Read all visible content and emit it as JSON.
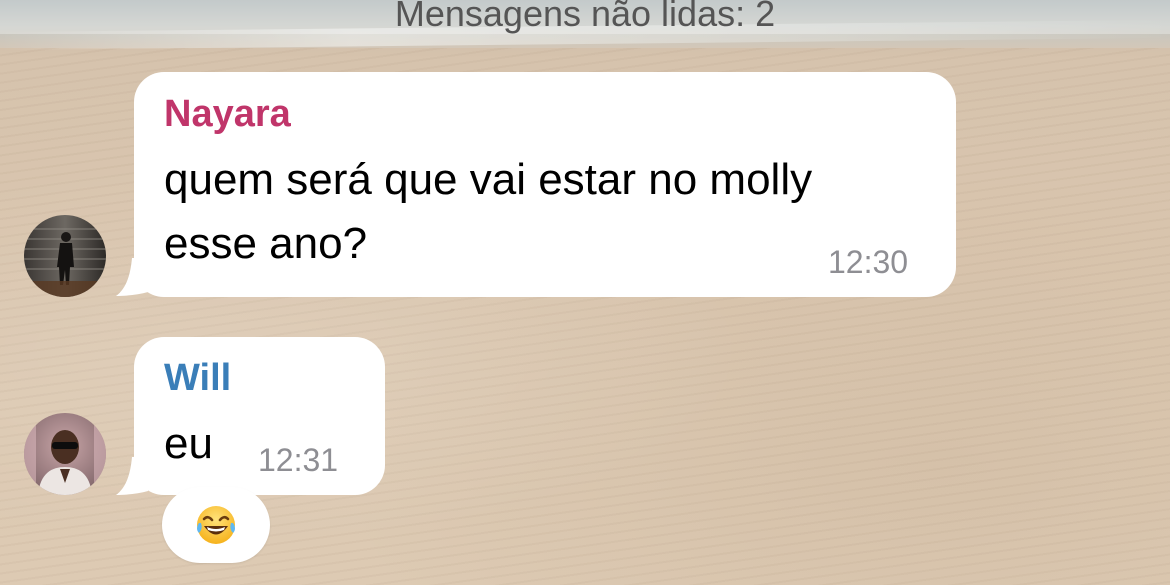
{
  "banner": {
    "unread_text": "Mensagens não lidas: 2"
  },
  "messages": [
    {
      "sender": "Nayara",
      "sender_color": "#c0356a",
      "line1": "quem será que vai estar no molly",
      "line2": "esse ano?",
      "time": "12:30",
      "avatar": "nayara-avatar"
    },
    {
      "sender": "Will",
      "sender_color": "#3a7eb8",
      "line1": "eu",
      "time": "12:31",
      "avatar": "will-avatar",
      "reaction": "😂",
      "reaction_icon": "laughing-tears-emoji"
    }
  ],
  "colors": {
    "bubble": "#ffffff",
    "timestamp": "#8e8e93"
  }
}
